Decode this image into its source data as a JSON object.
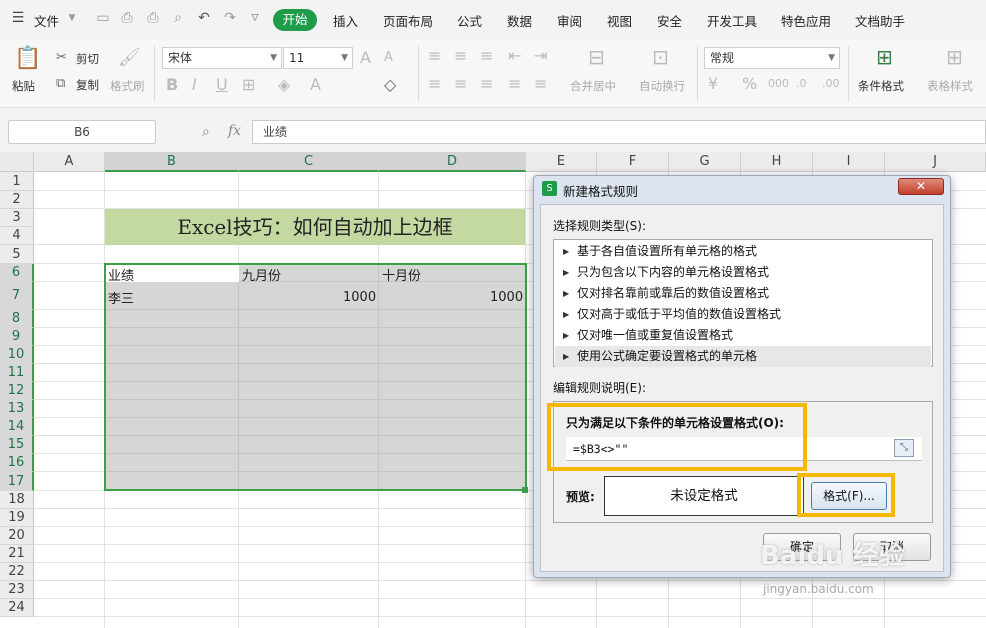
{
  "menubar": {
    "file": "文件",
    "tabs": [
      "开始",
      "插入",
      "页面布局",
      "公式",
      "数据",
      "审阅",
      "视图",
      "安全",
      "开发工具",
      "特色应用",
      "文档助手"
    ],
    "active": "开始"
  },
  "ribbon": {
    "paste": "粘贴",
    "cut": "剪切",
    "copy": "复制",
    "format_painter": "格式刷",
    "font_name": "宋体",
    "font_size": "11",
    "merge_center": "合并居中",
    "auto_wrap": "自动换行",
    "number_format": "常规",
    "conditional_format": "条件格式",
    "table_style": "表格样式"
  },
  "formula_bar": {
    "name_box": "B6",
    "fx": "fx",
    "content": "业绩"
  },
  "sheet": {
    "columns": [
      "A",
      "B",
      "C",
      "D",
      "E",
      "F",
      "G",
      "H",
      "I",
      "J"
    ],
    "rows": [
      "1",
      "2",
      "3",
      "4",
      "5",
      "6",
      "7",
      "8",
      "9",
      "10",
      "11",
      "12",
      "13",
      "14",
      "15",
      "16",
      "17",
      "18",
      "19",
      "20",
      "21",
      "22",
      "23",
      "24"
    ],
    "title": "Excel技巧：如何自动加上边框",
    "headers": [
      "业绩",
      "九月份",
      "十月份"
    ],
    "row7": {
      "name": "李三",
      "sep": "1000",
      "oct": "1000"
    }
  },
  "dialog": {
    "title": "新建格式规则",
    "close": "✕",
    "select_type_label": "选择规则类型(S):",
    "rules": [
      "基于各自值设置所有单元格的格式",
      "只为包含以下内容的单元格设置格式",
      "仅对排名靠前或靠后的数值设置格式",
      "仅对高于或低于平均值的数值设置格式",
      "仅对唯一值或重复值设置格式",
      "使用公式确定要设置格式的单元格"
    ],
    "edit_label": "编辑规则说明(E):",
    "formula_label": "只为满足以下条件的单元格设置格式(O):",
    "formula": "=$B3<>\"\"",
    "preview_label": "预览:",
    "preview_text": "未设定格式",
    "format_button": "格式(F)...",
    "ok": "确定",
    "cancel": "取消"
  },
  "watermark": {
    "line1": "Baidu 经验",
    "line2": "jingyan.baidu.com"
  },
  "colors": {
    "accent": "#1f9c4a",
    "selection": "#3aa34a",
    "highlight": "#f5b800",
    "title_fill": "#c4d9a1"
  }
}
